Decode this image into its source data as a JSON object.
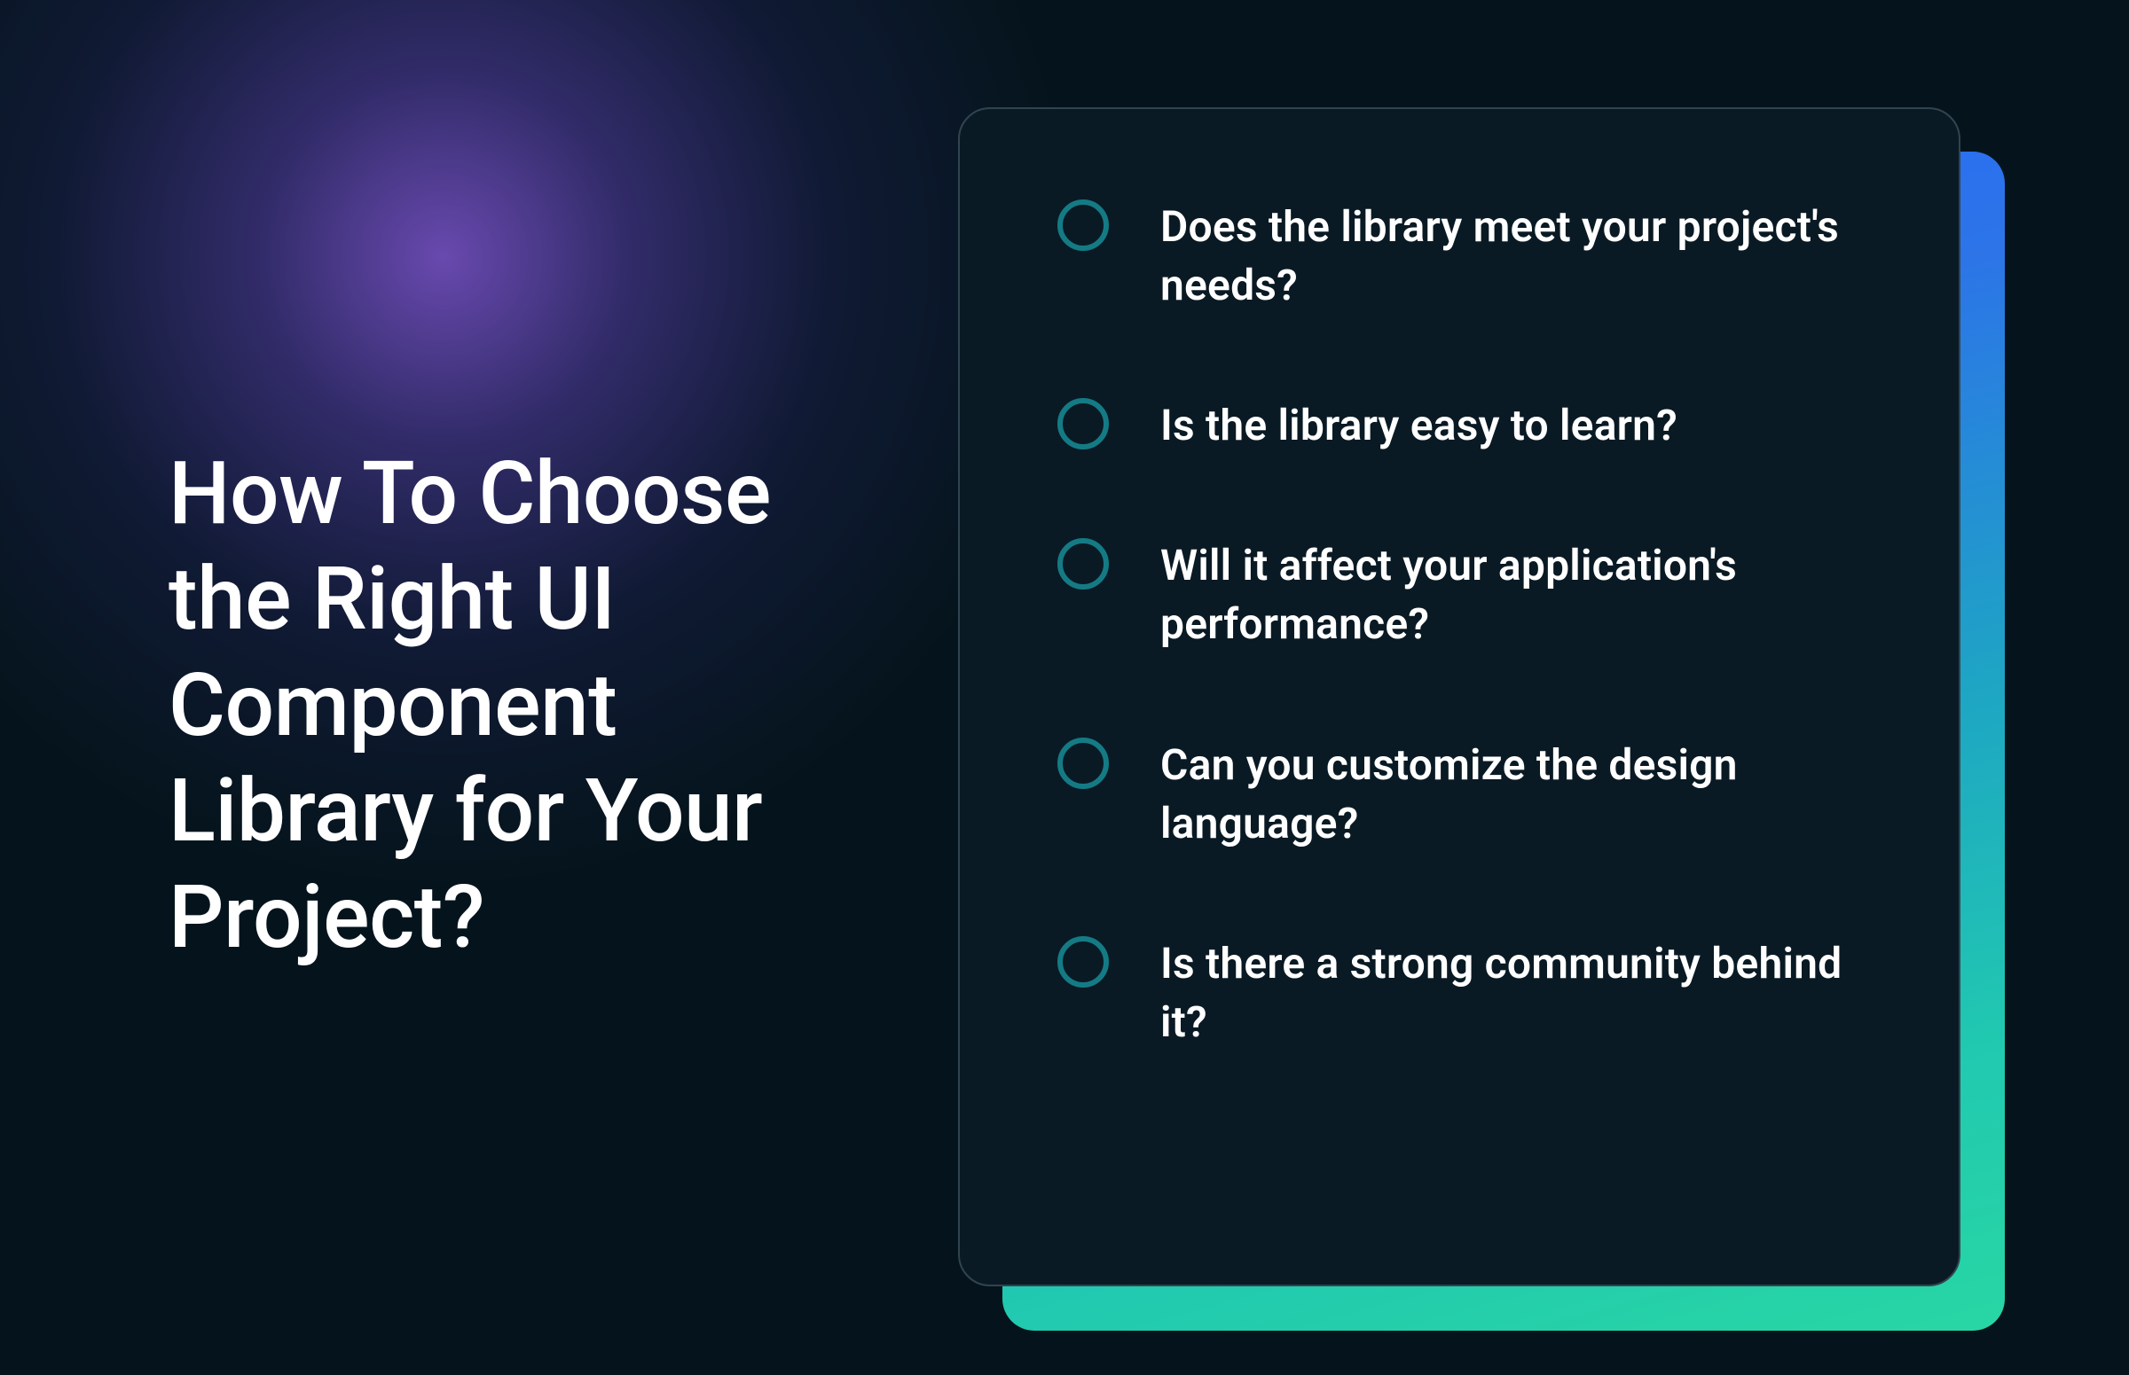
{
  "heading": "How To Choose the Right UI Component Library for Your Project?",
  "items": [
    {
      "text": "Does the library meet your project's needs?"
    },
    {
      "text": "Is the library easy to learn?"
    },
    {
      "text": "Will it affect your application's performance?"
    },
    {
      "text": "Can you customize the design language?"
    },
    {
      "text": "Is there a strong community behind it?"
    }
  ],
  "colors": {
    "background": "#05141c",
    "card_bg": "#0a1a24",
    "card_border": "#30444f",
    "circle_border": "#147b85",
    "text": "#ffffff",
    "gradient_start": "#2968ff",
    "gradient_end": "#28d6a4",
    "glow": "#7b5cd8"
  }
}
